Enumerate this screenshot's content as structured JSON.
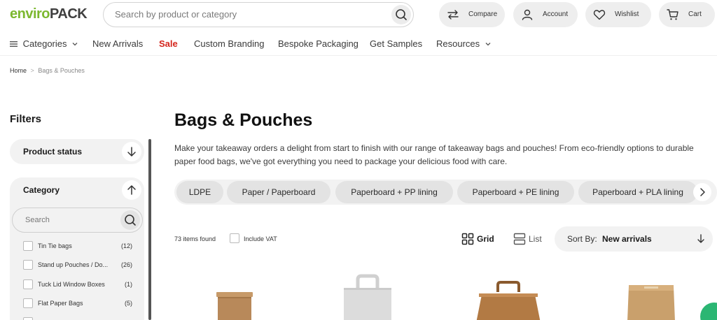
{
  "brand": {
    "part1": "enviro",
    "part2": "PACK",
    "color1": "#7cb82f",
    "color2": "#3f3f3f"
  },
  "header": {
    "search_placeholder": "Search by product or category",
    "buttons": {
      "compare": "Compare",
      "account": "Account",
      "wishlist": "Wishlist",
      "cart": "Cart"
    }
  },
  "nav": {
    "categories": "Categories",
    "new_arrivals": "New Arrivals",
    "sale": "Sale",
    "custom_branding": "Custom Branding",
    "bespoke": "Bespoke Packaging",
    "samples": "Get Samples",
    "resources": "Resources"
  },
  "breadcrumb": {
    "home": "Home",
    "sep": ">",
    "current": "Bags & Pouches"
  },
  "filters": {
    "title": "Filters",
    "product_status": "Product status",
    "category": "Category",
    "search_placeholder": "Search",
    "items": [
      {
        "name": "Tin Tie bags",
        "count": "(12)"
      },
      {
        "name": "Stand up Pouches / Do...",
        "count": "(26)"
      },
      {
        "name": "Tuck Lid Window Boxes",
        "count": "(1)"
      },
      {
        "name": "Flat Paper Bags",
        "count": "(5)"
      }
    ]
  },
  "main": {
    "title": "Bags & Pouches",
    "description": "Make your takeaway orders a delight from start to finish with our range of takeaway bags and pouches! From eco-friendly options to durable paper food bags, we've got everything you need to package your delicious food with care.",
    "chips": [
      "LDPE",
      "Paper / Paperboard",
      "Paperboard + PP lining",
      "Paperboard + PE lining",
      "Paperboard + PLA lining"
    ]
  },
  "toolbar": {
    "items_found": "73 items found",
    "include_vat": "Include VAT",
    "grid": "Grid",
    "list": "List",
    "sort_label": "Sort By:",
    "sort_value": "New arrivals"
  },
  "colors": {
    "sale": "#d4241b",
    "panel": "#f2f2f2",
    "chat": "#2bb673"
  }
}
